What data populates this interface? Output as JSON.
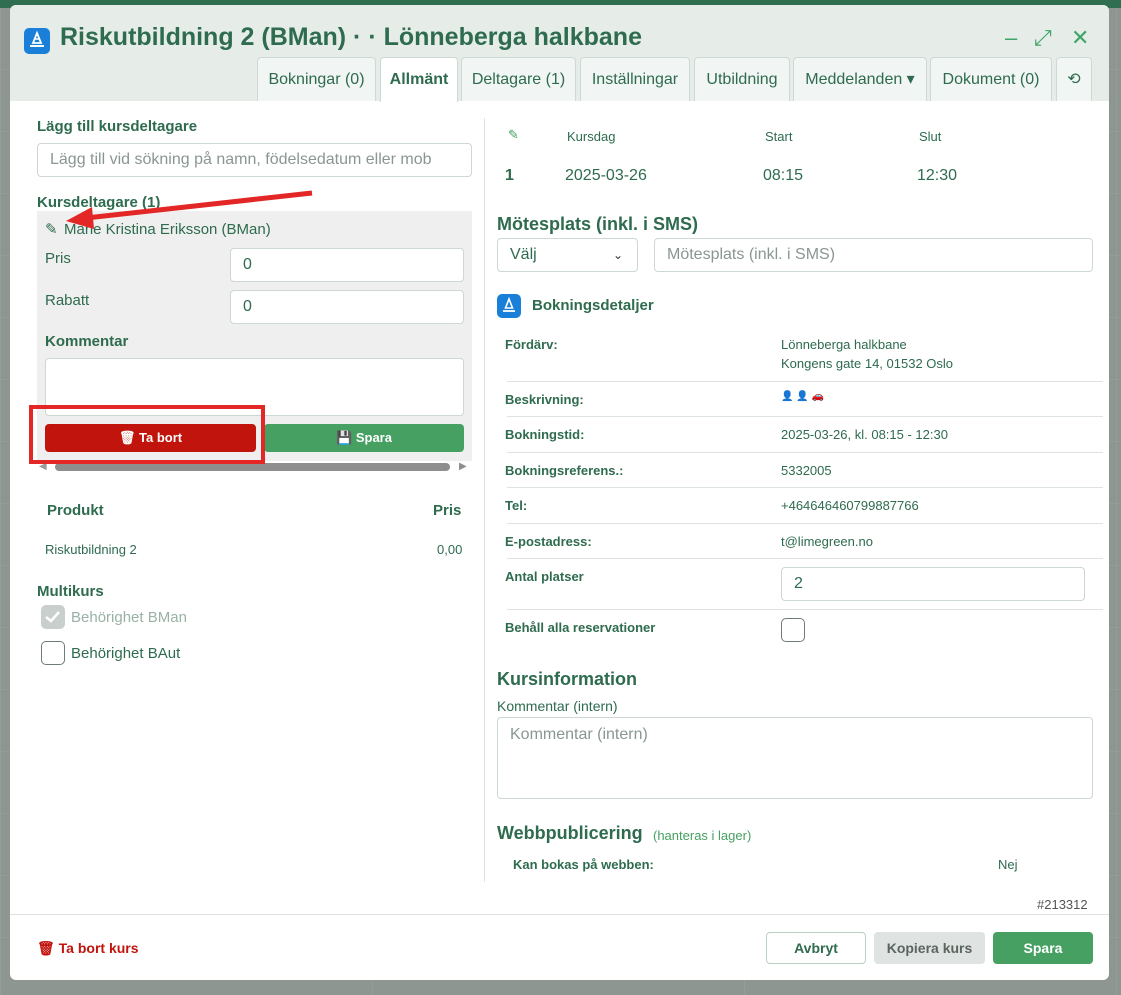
{
  "window": {
    "title": "Riskutbildning 2 (BMan) · · Lönneberga halkbane",
    "minimize_glyph": "–",
    "maximize_glyph": "⤢",
    "close_glyph": "✕"
  },
  "tabs": [
    {
      "label": "Bokningar (0)"
    },
    {
      "label": "Allmänt"
    },
    {
      "label": "Deltagare (1)"
    },
    {
      "label": "Inställningar"
    },
    {
      "label": "Utbildning"
    },
    {
      "label": "Meddelanden ▾"
    },
    {
      "label": "Dokument (0)"
    },
    {
      "label": "⟲"
    }
  ],
  "left": {
    "add_participant_label": "Lägg till kursdeltagare",
    "search_placeholder": "Lägg till vid sökning på namn, födelsedatum eller mob",
    "participants_label": "Kursdeltagare (1)",
    "participant_name": "Marie Kristina Eriksson (BMan)",
    "price_label": "Pris",
    "price_value": "0",
    "discount_label": "Rabatt",
    "discount_value": "0",
    "comment_label": "Kommentar",
    "remove_label": "Ta bort",
    "save_label": "Spara",
    "product_header": "Produkt",
    "price_header": "Pris",
    "product_name": "Riskutbildning 2",
    "product_price": "0,00",
    "multikurs_label": "Multikurs",
    "multikurs_items": [
      {
        "label": "Behörighet BMan",
        "checked": true,
        "disabled": true
      },
      {
        "label": "Behörighet BAut",
        "checked": false,
        "disabled": false
      }
    ]
  },
  "schedule": {
    "headers": {
      "day": "Kursdag",
      "start": "Start",
      "end": "Slut"
    },
    "row": {
      "num": "1",
      "day": "2025-03-26",
      "start": "08:15",
      "end": "12:30"
    }
  },
  "meeting": {
    "title": "Mötesplats (inkl. i SMS)",
    "select_value": "Välj",
    "input_placeholder": "Mötesplats (inkl. i SMS)"
  },
  "booking": {
    "title": "Bokningsdetaljer",
    "rows": [
      {
        "label": "Fördärv:",
        "value": "Lönneberga halkbane",
        "value2": "Kongens gate 14, 01532 Oslo"
      },
      {
        "label": "Beskrivning:",
        "value": "👤 👤 🚗"
      },
      {
        "label": "Bokningstid:",
        "value": "2025-03-26, kl. 08:15 - 12:30"
      },
      {
        "label": "Bokningsreferens.:",
        "value": "5332005"
      },
      {
        "label": "Tel:",
        "value": "+464646460799887766"
      },
      {
        "label": "E-postadress:",
        "value": "t@limegreen.no"
      }
    ],
    "seats_label": "Antal platser",
    "seats_value": "2",
    "keep_label": "Behåll alla reservationer"
  },
  "course_info": {
    "title": "Kursinformation",
    "comment_label": "Kommentar (intern)",
    "comment_placeholder": "Kommentar (intern)"
  },
  "web": {
    "title": "Webbpublicering",
    "note": "(hanteras i lager)",
    "bookable_label": "Kan bokas på webben:",
    "bookable_value": "Nej"
  },
  "footer": {
    "id": "#213312",
    "delete_course": "Ta bort kurs",
    "cancel": "Avbryt",
    "copy": "Kopiera kurs",
    "save": "Spara"
  },
  "colors": {
    "primary": "#2e6b4f",
    "accent_green": "#46a062",
    "danger": "#c0140c",
    "annotation_red": "#e32626"
  }
}
